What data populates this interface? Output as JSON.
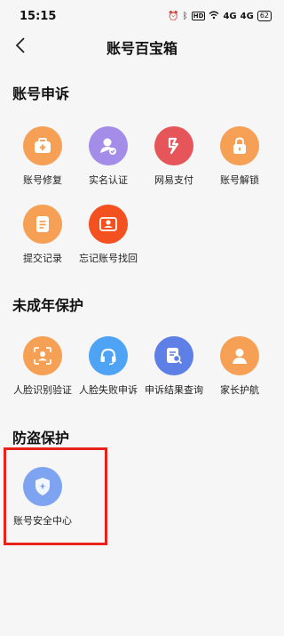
{
  "status": {
    "time": "15:15",
    "net1": "HD",
    "sig1": "4G",
    "sig2": "4G",
    "battery": "62"
  },
  "header": {
    "title": "账号百宝箱"
  },
  "sections": {
    "appeal": {
      "title": "账号申诉",
      "items": [
        {
          "label": "账号修复",
          "icon": "medical-kit-icon"
        },
        {
          "label": "实名认证",
          "icon": "verified-user-icon"
        },
        {
          "label": "网易支付",
          "icon": "netease-pay-icon"
        },
        {
          "label": "账号解锁",
          "icon": "lock-icon"
        },
        {
          "label": "提交记录",
          "icon": "document-icon"
        },
        {
          "label": "忘记账号找回",
          "icon": "id-card-icon"
        }
      ]
    },
    "minor": {
      "title": "未成年保护",
      "items": [
        {
          "label": "人脸识别验证",
          "icon": "face-scan-icon"
        },
        {
          "label": "人脸失败申诉",
          "icon": "headset-icon"
        },
        {
          "label": "申诉结果查询",
          "icon": "search-document-icon"
        },
        {
          "label": "家长护航",
          "icon": "person-icon"
        }
      ]
    },
    "theft": {
      "title": "防盗保护",
      "items": [
        {
          "label": "账号安全中心",
          "icon": "shield-icon"
        }
      ]
    }
  }
}
